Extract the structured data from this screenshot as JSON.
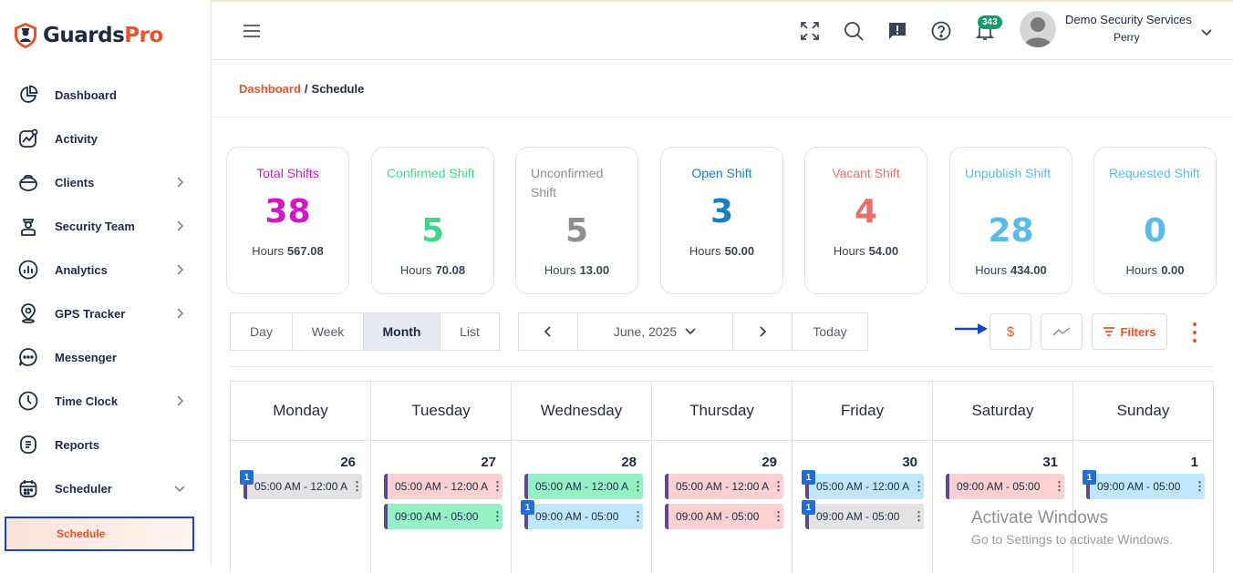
{
  "brand": {
    "part1": "Guards",
    "part2": "Pro",
    "accent": "#e8532b",
    "dark": "#1f2a44"
  },
  "sidebar": {
    "items": [
      {
        "label": "Dashboard",
        "icon": "pie-chart-icon",
        "chevron": false
      },
      {
        "label": "Activity",
        "icon": "activity-icon",
        "chevron": false
      },
      {
        "label": "Clients",
        "icon": "briefcase-icon",
        "chevron": true
      },
      {
        "label": "Security Team",
        "icon": "guard-icon",
        "chevron": true
      },
      {
        "label": "Analytics",
        "icon": "bar-chart-icon",
        "chevron": true
      },
      {
        "label": "GPS Tracker",
        "icon": "location-pin-icon",
        "chevron": true
      },
      {
        "label": "Messenger",
        "icon": "chat-bubble-icon",
        "chevron": false
      },
      {
        "label": "Time Clock",
        "icon": "clock-icon",
        "chevron": true
      },
      {
        "label": "Reports",
        "icon": "report-icon",
        "chevron": false
      },
      {
        "label": "Scheduler",
        "icon": "calendar-icon",
        "chevron": "down"
      }
    ],
    "sub_item": "Schedule"
  },
  "header": {
    "notification_count": "343",
    "user_company": "Demo Security Services",
    "user_name": "Perry"
  },
  "breadcrumb": {
    "link": "Dashboard",
    "separator": "/",
    "current": "Schedule"
  },
  "stats": [
    {
      "title": "Total Shifts",
      "value": "38",
      "hours_label": "Hours",
      "hours": "567.08",
      "color": "#d417c4"
    },
    {
      "title": "Confirmed Shift",
      "value": "5",
      "hours_label": "Hours",
      "hours": "70.08",
      "color": "#3ed78c"
    },
    {
      "title": "Unconfirmed Shift",
      "value": "5",
      "hours_label": "Hours",
      "hours": "13.00",
      "color": "#8e8e8e"
    },
    {
      "title": "Open Shift",
      "value": "3",
      "hours_label": "Hours",
      "hours": "50.00",
      "color": "#1a7fc1"
    },
    {
      "title": "Vacant Shift",
      "value": "4",
      "hours_label": "Hours",
      "hours": "54.00",
      "color": "#e86f6f"
    },
    {
      "title": "Unpublish Shift",
      "value": "28",
      "hours_label": "Hours",
      "hours": "434.00",
      "color": "#5bbbe8"
    },
    {
      "title": "Requested Shift",
      "value": "0",
      "hours_label": "Hours",
      "hours": "0.00",
      "color": "#5bbbe8"
    }
  ],
  "views": [
    "Day",
    "Week",
    "Month",
    "List"
  ],
  "active_view": "Month",
  "nav": {
    "period": "June, 2025",
    "today": "Today"
  },
  "tools": {
    "currency_symbol": "$",
    "filters_label": "Filters"
  },
  "calendar": {
    "days": [
      "Monday",
      "Tuesday",
      "Wednesday",
      "Thursday",
      "Friday",
      "Saturday",
      "Sunday"
    ],
    "dates": [
      "26",
      "27",
      "28",
      "29",
      "30",
      "31",
      "1"
    ],
    "events": [
      [
        {
          "text": "05:00 AM - 12:00 A",
          "color": "gray",
          "count": "1"
        }
      ],
      [
        {
          "text": "05:00 AM - 12:00 A",
          "color": "pink"
        },
        {
          "text": "09:00 AM - 05:00",
          "color": "green"
        }
      ],
      [
        {
          "text": "05:00 AM - 12:00 A",
          "color": "green"
        },
        {
          "text": "09:00 AM - 05:00",
          "color": "blue",
          "count": "1"
        }
      ],
      [
        {
          "text": "05:00 AM - 12:00 A",
          "color": "pink"
        },
        {
          "text": "09:00 AM - 05:00",
          "color": "pink"
        }
      ],
      [
        {
          "text": "05:00 AM - 12:00 A",
          "color": "blue",
          "count": "1"
        },
        {
          "text": "09:00 AM - 05:00",
          "color": "gray",
          "count": "1"
        }
      ],
      [
        {
          "text": "09:00 AM - 05:00",
          "color": "pink"
        }
      ],
      [
        {
          "text": "09:00 AM - 05:00",
          "color": "blue",
          "count": "1"
        }
      ]
    ]
  },
  "watermark": {
    "line1": "Activate Windows",
    "line2": "Go to Settings to activate Windows."
  }
}
